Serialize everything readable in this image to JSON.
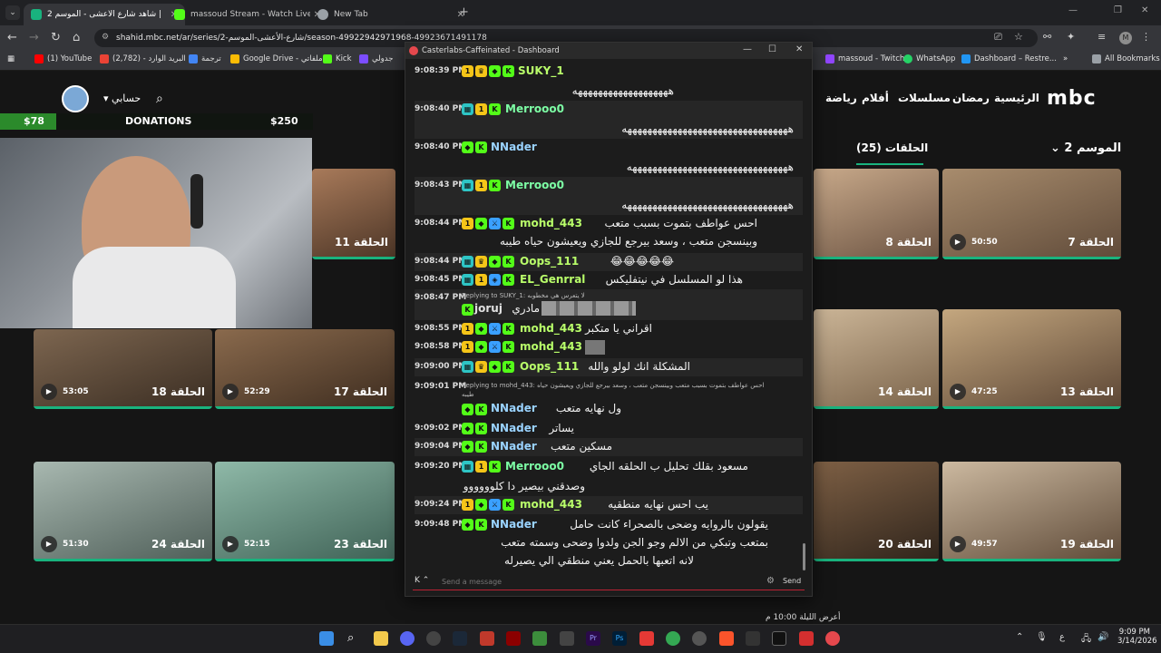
{
  "browser": {
    "tabs": [
      {
        "title": "شاهد شارع الأعشى - الموسم 2 |",
        "active": true,
        "color": "#19b37e"
      },
      {
        "title": "massoud Stream - Watch Live o",
        "active": false,
        "color": "#53fc18"
      },
      {
        "title": "New Tab",
        "active": false,
        "color": "#9aa0a6"
      }
    ],
    "url": "shahid.mbc.net/ar/series/2-شارع-الأعشى-الموسم/season-49922942971968-49923671491178",
    "bookmarks": [
      {
        "label": "(1) YouTube",
        "color": "#ff0000"
      },
      {
        "label": "(2,782) - البريد الوارد",
        "color": "#ea4335"
      },
      {
        "label": "ترجمة",
        "color": "#4285f4"
      },
      {
        "label": "Google Drive - ملفاتي",
        "color": "#fbbc04"
      },
      {
        "label": "Kick",
        "color": "#53fc18"
      },
      {
        "label": "جدولي",
        "color": "#7c4dff"
      },
      {
        "label": "massoud - Twitch",
        "color": "#9146ff"
      },
      {
        "label": "WhatsApp",
        "color": "#25d366"
      },
      {
        "label": "Dashboard – Restre...",
        "color": "#2196f3"
      },
      {
        "label": "All Bookmarks",
        "color": "#9aa0a6"
      }
    ]
  },
  "site": {
    "logo": "mbc",
    "nav": [
      "الرئيسية",
      "رمضان",
      "مسلسلات",
      "أفلام",
      "رياضة"
    ],
    "account": "حسابي",
    "season": "الموسم 2",
    "episodes_label": "الحلقات (25)",
    "footer_text": "أعرض الليلة 10:00 م",
    "row1": [
      {
        "ep": "الحلقة 7",
        "dur": "50:50"
      },
      {
        "ep": "الحلقة 8",
        "dur": ""
      },
      {
        "ep": "الحلقة 11",
        "dur": ""
      }
    ],
    "row2": [
      {
        "ep": "الحلقة 13",
        "dur": "47:25"
      },
      {
        "ep": "الحلقة 14",
        "dur": ""
      },
      {
        "ep": "الحلقة 17",
        "dur": "52:29"
      },
      {
        "ep": "الحلقة 18",
        "dur": "53:05"
      }
    ],
    "row3": [
      {
        "ep": "الحلقة 19",
        "dur": "49:57"
      },
      {
        "ep": "الحلقة 20",
        "dur": ""
      },
      {
        "ep": "الحلقة 23",
        "dur": "52:15"
      },
      {
        "ep": "الحلقة 24",
        "dur": "51:30"
      }
    ]
  },
  "overlay": {
    "left_amount": "$78",
    "label": "DONATIONS",
    "right_amount": "$250"
  },
  "dashboard": {
    "title": "Casterlabs-Caffeinated - Dashboard",
    "input_placeholder": "Send a message",
    "send_label": "Send",
    "messages": [
      {
        "time": "9:08:39 PM",
        "user": "SUKY_1",
        "color": "#b9ff6a",
        "text": "",
        "text2": "هههههههههههههههههههه"
      },
      {
        "time": "9:08:40 PM",
        "user": "Merrooo0",
        "color": "#7dffa5",
        "text": "",
        "text2": "هههههههههههههههههههههههههههههههههه"
      },
      {
        "time": "9:08:40 PM",
        "user": "NNader",
        "color": "#9ad3ff",
        "text": "",
        "text2": "ههههههههههههههههههههههههههههههههه"
      },
      {
        "time": "9:08:43 PM",
        "user": "Merrooo0",
        "color": "#7dffa5",
        "text": "",
        "text2": "هههههههههههههههههههههههههههههههههه"
      },
      {
        "time": "9:08:44 PM",
        "user": "mohd_443",
        "color": "#b9ff6a",
        "text": "احس عواطف بتموت بسبب متعب",
        "text2": "وبينسجن متعب ، وسعد بيرجع للجازي ويعيشون حياه طيبه"
      },
      {
        "time": "9:08:44 PM",
        "user": "Oops_111",
        "color": "#b9ff6a",
        "text": "😂😂😂😂😂",
        "text2": ""
      },
      {
        "time": "9:08:45 PM",
        "user": "EL_Genrral",
        "color": "#b9ff6a",
        "text": "هذا لو المسلسل في نيتفليكس",
        "text2": ""
      },
      {
        "time": "9:08:47 PM",
        "user": "joruj",
        "color": "#e0e0e0",
        "text": "مادري",
        "reply": "Replying to SUKY_1: لا يتعرس هي مخطوبه",
        "text2": ""
      },
      {
        "time": "9:08:55 PM",
        "user": "mohd_443",
        "color": "#b9ff6a",
        "text": "اقراني يا متكبر",
        "text2": ""
      },
      {
        "time": "9:08:58 PM",
        "user": "mohd_443",
        "color": "#b9ff6a",
        "text": "",
        "text2": ""
      },
      {
        "time": "9:09:00 PM",
        "user": "Oops_111",
        "color": "#b9ff6a",
        "text": "المشكلة انك لولو والله",
        "text2": ""
      },
      {
        "time": "9:09:01 PM",
        "user": "NNader",
        "color": "#9ad3ff",
        "text": "ول نهايه متعب",
        "reply": "Replying to mohd_443: احس عواطف بتموت بسبب متعب وبينسجن متعب ، وسعد بيرجع للجازي ويعيشون حياه طيبه",
        "text2": ""
      },
      {
        "time": "9:09:02 PM",
        "user": "NNader",
        "color": "#9ad3ff",
        "text": "يساتر",
        "text2": ""
      },
      {
        "time": "9:09:04 PM",
        "user": "NNader",
        "color": "#9ad3ff",
        "text": "مسكين متعب",
        "text2": ""
      },
      {
        "time": "9:09:20 PM",
        "user": "Merrooo0",
        "color": "#7dffa5",
        "text": "مسعود بقلك تحليل ب الحلقه الجاي",
        "text2": "وصدقني بيصير دا كلوووووو"
      },
      {
        "time": "9:09:24 PM",
        "user": "mohd_443",
        "color": "#b9ff6a",
        "text": "يب احس نهايه منطقيه",
        "text2": ""
      },
      {
        "time": "9:09:48 PM",
        "user": "NNader",
        "color": "#9ad3ff",
        "text": "يقولون بالروايه وضحى بالصحراء كانت حامل",
        "text2": "بمتعب وتبكي من الالم وجو الجن ولدوا وضحى وسمته متعب",
        "text3": "لانه اتعبها بالحمل يعني منطقي الي يصيرله"
      }
    ]
  },
  "taskbar": {
    "time": "9:09 PM",
    "date": "3/14/2026",
    "lang": "ع"
  }
}
